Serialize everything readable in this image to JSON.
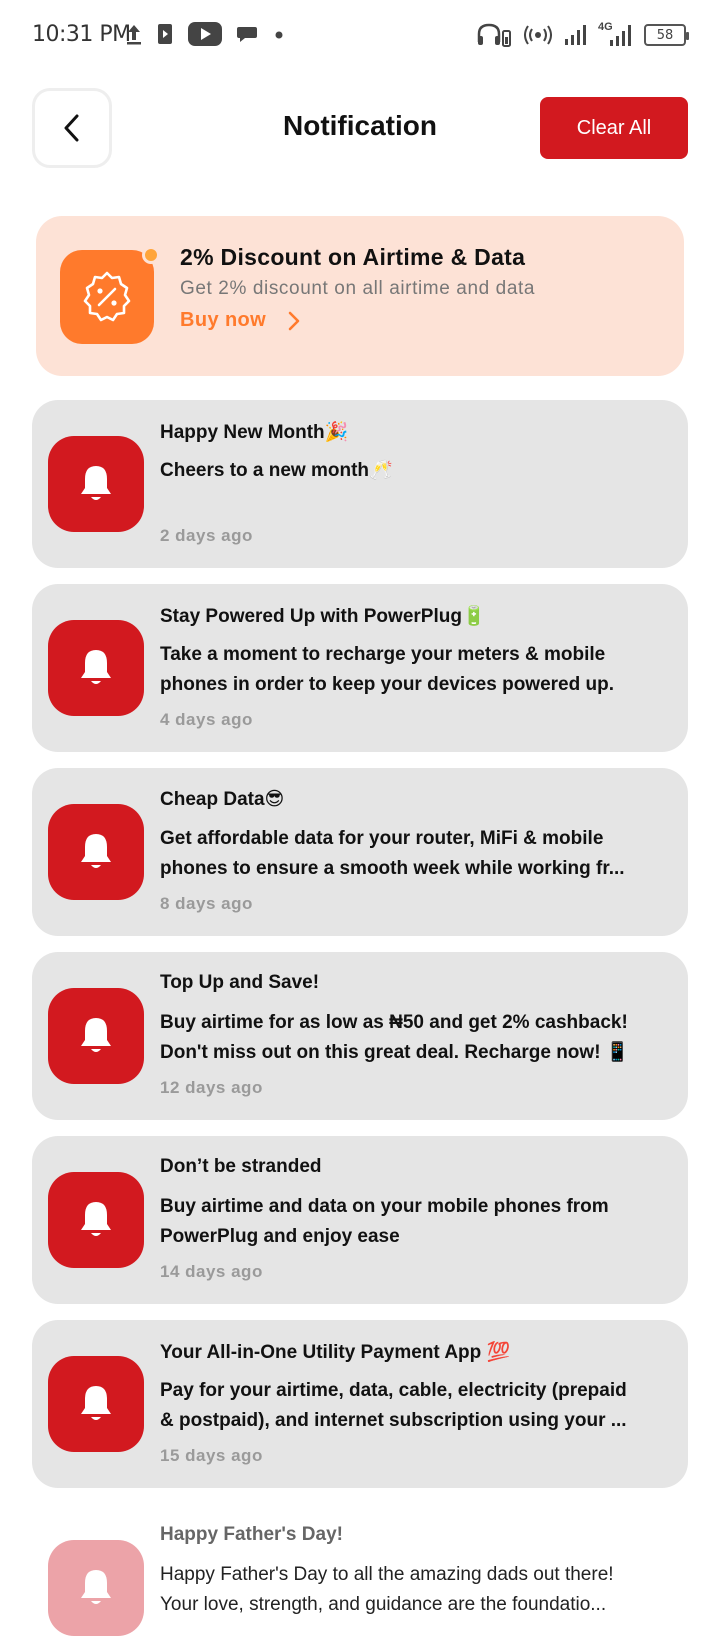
{
  "status_bar": {
    "time": "10:31 PM",
    "battery": "58",
    "network": "4G",
    "left_icons": [
      "upload-icon",
      "media-icon",
      "youtube-icon",
      "chat-icon",
      "dot-icon"
    ],
    "right_icons": [
      "headset-icon",
      "hotspot-icon",
      "signal-icon",
      "signal-4g-icon",
      "battery-icon"
    ]
  },
  "header": {
    "title": "Notification",
    "clear_label": "Clear All"
  },
  "promo": {
    "title": "2% Discount on Airtime & Data",
    "subtitle": "Get 2% discount on all airtime and data",
    "link_label": "Buy now"
  },
  "notifications": [
    {
      "title": "Happy New Month🎉",
      "lines": [
        "Cheers to a new month🥂"
      ],
      "time": "2 days ago"
    },
    {
      "title": "Stay Powered Up with PowerPlug🔋",
      "lines": [
        "Take a moment to recharge your meters & mobile",
        "phones in order to keep your devices powered up."
      ],
      "time": "4 days ago"
    },
    {
      "title": "Cheap Data😎",
      "lines": [
        "Get affordable data for your router, MiFi & mobile",
        "phones to ensure a smooth week while working fr..."
      ],
      "time": "8 days ago"
    },
    {
      "title": "Top Up and Save!",
      "lines": [
        "Buy airtime for as low as ₦50 and get 2% cashback!",
        "Don't miss out on this great deal. Recharge now! 📱"
      ],
      "time": "12 days ago"
    },
    {
      "title": "Don’t be stranded",
      "lines": [
        "Buy airtime and data on your mobile phones from",
        "PowerPlug and enjoy ease"
      ],
      "time": "14 days ago"
    },
    {
      "title": "Your All-in-One Utility Payment App 💯",
      "lines": [
        "Pay for your airtime, data, cable, electricity (prepaid",
        "& postpaid), and internet subscription using your ..."
      ],
      "time": "15 days ago"
    },
    {
      "title": "Happy Father's Day!",
      "lines": [
        "Happy Father's Day to all the amazing dads out there!",
        "Your love, strength, and guidance are the foundatio..."
      ],
      "time": ""
    }
  ],
  "colors": {
    "brand_red": "#d2191f",
    "promo_bg": "#fde2d6",
    "promo_orange": "#ff7a2c",
    "card_bg": "#e5e5e5"
  }
}
